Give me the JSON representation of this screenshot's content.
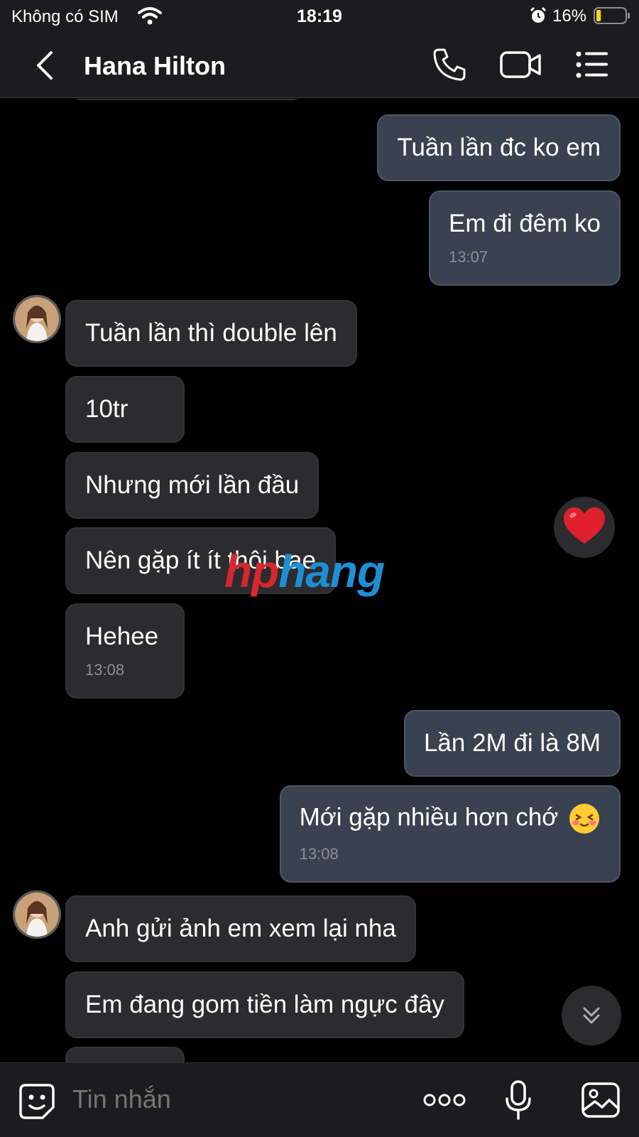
{
  "status_bar": {
    "carrier": "Không có SIM",
    "time": "18:19",
    "battery_percent": "16%",
    "battery_level": 0.16
  },
  "header": {
    "contact_name": "Hana Hilton",
    "icons": [
      "back-icon",
      "phone-icon",
      "video-call-icon",
      "menu-list-icon"
    ]
  },
  "messages": [
    {
      "direction": "out",
      "text": "Tuần lần đc ko em"
    },
    {
      "direction": "out",
      "text": "Em đi đêm ko",
      "time": "13:07"
    },
    {
      "direction": "in",
      "text": "Tuần lần thì double lên"
    },
    {
      "direction": "in",
      "text": "10tr"
    },
    {
      "direction": "in",
      "text": "Nhưng mới lần đầu"
    },
    {
      "direction": "in",
      "text": "Nên gặp ít ít thôi bae"
    },
    {
      "direction": "in",
      "text": "Hehee",
      "time": "13:08"
    },
    {
      "direction": "out",
      "text": "Lần 2M đi là 8M"
    },
    {
      "direction": "out",
      "text": "Mới gặp nhiều hơn chớ",
      "emoji": "blushing-face",
      "time": "13:08"
    },
    {
      "direction": "in",
      "text": "Anh gửi ảnh em xem lại nha"
    },
    {
      "direction": "in",
      "text": "Em đang gom tiền làm ngực đây"
    }
  ],
  "reaction": {
    "emoji": "red-heart"
  },
  "watermark": {
    "part1": "hp",
    "part2": "hang"
  },
  "input_bar": {
    "placeholder": "Tin nhắn",
    "icons": [
      "sticker-icon",
      "more-options-icon",
      "microphone-icon",
      "image-icon"
    ]
  }
}
